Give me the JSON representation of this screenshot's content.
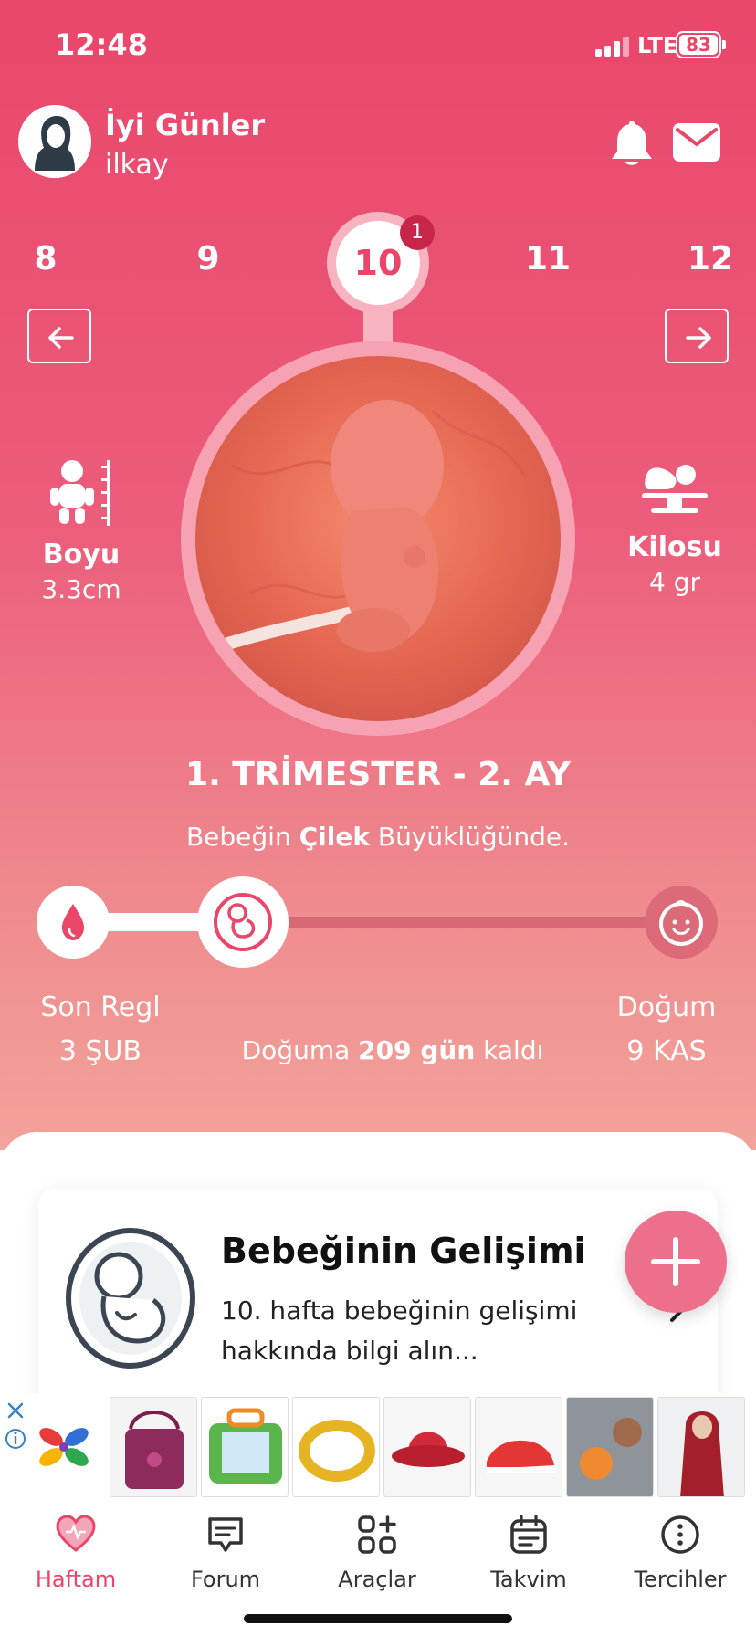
{
  "status": {
    "time": "12:48",
    "network": "LTE",
    "battery": "83"
  },
  "header": {
    "greeting": "İyi Günler",
    "username": "ilkay"
  },
  "weeks": {
    "items": [
      "8",
      "9",
      "10",
      "11",
      "12"
    ],
    "current": "10",
    "badge": "1"
  },
  "baby": {
    "height_label": "Boyu",
    "height_value": "3.3cm",
    "weight_label": "Kilosu",
    "weight_value": "4 gr"
  },
  "trimester": "1. TRİMESTER - 2. AY",
  "size_text": {
    "pre": "Bebeğin ",
    "fruit": "Çilek",
    "post": " Büyüklüğünde."
  },
  "timeline": {
    "start_label": "Son Regl",
    "start_date": "3 ŞUB",
    "end_label": "Doğum",
    "end_date": "9 KAS",
    "countdown_pre": "Doğuma ",
    "countdown_bold": "209 gün",
    "countdown_post": " kaldı",
    "progress": 0.22
  },
  "card": {
    "title": "Bebeğinin Gelişimi",
    "desc": "10. hafta bebeğinin gelişimi hakkında bilgi alın..."
  },
  "nav": [
    {
      "label": "Haftam",
      "icon": "heart-icon",
      "active": true
    },
    {
      "label": "Forum",
      "icon": "chat-icon"
    },
    {
      "label": "Araçlar",
      "icon": "tools-icon"
    },
    {
      "label": "Takvim",
      "icon": "calendar-icon"
    },
    {
      "label": "Tercihler",
      "icon": "more-icon"
    }
  ],
  "colors": {
    "brand": "#e9466a",
    "badge": "#c7254a",
    "fab": "#ec6f8b"
  }
}
